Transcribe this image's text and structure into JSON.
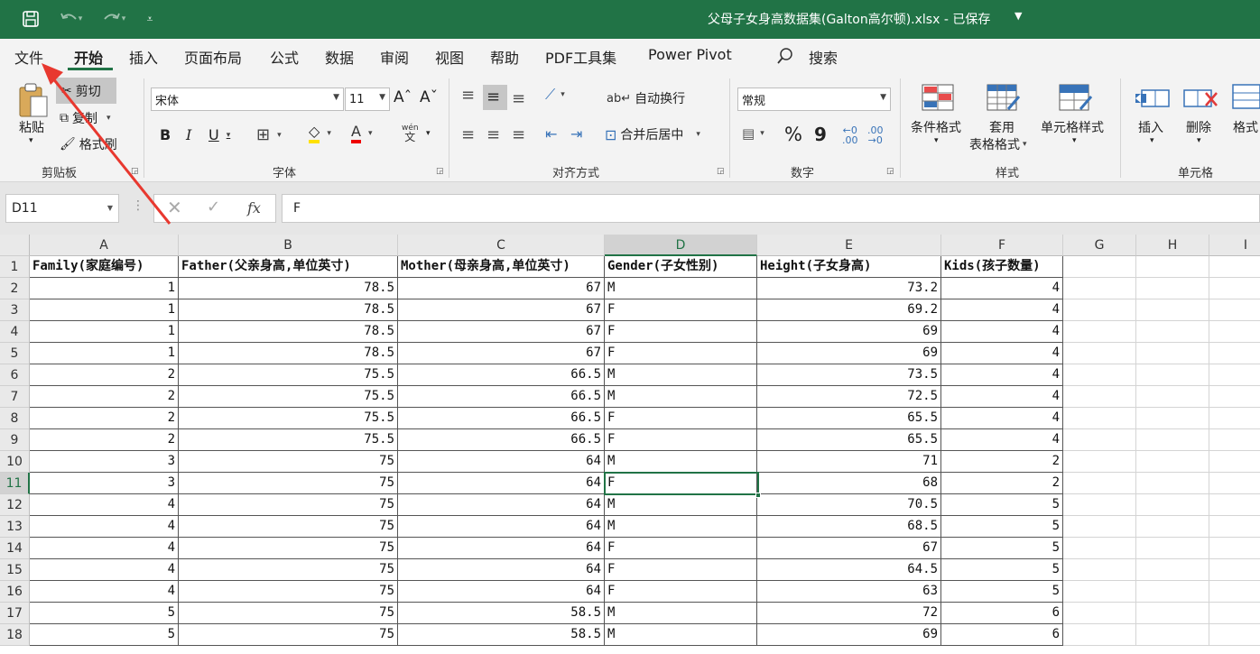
{
  "title_bar": {
    "doc_title": "父母子女身高数据集(Galton高尔顿).xlsx  -  已保存",
    "bg_color": "#217346",
    "icons": [
      "save-icon",
      "undo-icon",
      "redo-icon",
      "customize-icon"
    ]
  },
  "menu": {
    "tabs": [
      "文件",
      "开始",
      "插入",
      "页面布局",
      "公式",
      "数据",
      "审阅",
      "视图",
      "帮助",
      "PDF工具集",
      "Power Pivot"
    ],
    "active": "开始",
    "search_label": "搜索"
  },
  "ribbon": {
    "clipboard": {
      "paste": "粘贴",
      "cut": "剪切",
      "copy": "复制",
      "format_painter": "格式刷",
      "label": "剪贴板"
    },
    "font": {
      "font_name": "宋体",
      "font_size": "11",
      "label": "字体",
      "phonetic": "wén"
    },
    "alignment": {
      "wrap_text": "自动换行",
      "merge_center": "合并后居中",
      "label": "对齐方式"
    },
    "number": {
      "format": "常规",
      "percent": "%",
      "comma": "9",
      "label": "数字"
    },
    "styles": {
      "conditional": "条件格式",
      "table_line1": "套用",
      "table_line2": "表格格式",
      "cell_styles": "单元格样式",
      "label": "样式"
    },
    "cells": {
      "insert": "插入",
      "delete": "删除",
      "format": "格式",
      "label": "单元格"
    }
  },
  "formula_bar": {
    "name_box": "D11",
    "fx": "fx",
    "content": "F"
  },
  "sheet": {
    "columns": [
      "A",
      "B",
      "C",
      "D",
      "E",
      "F",
      "G",
      "H",
      "I"
    ],
    "selected_column": "D",
    "selected_row": 11,
    "active_cell": "D11",
    "header_row": [
      "Family(家庭编号)",
      "Father(父亲身高,单位英寸)",
      "Mother(母亲身高,单位英寸)",
      "Gender(子女性别)",
      "Height(子女身高)",
      "Kids(孩子数量)"
    ],
    "rows": [
      [
        "1",
        "78.5",
        "67",
        "M",
        "73.2",
        "4"
      ],
      [
        "1",
        "78.5",
        "67",
        "F",
        "69.2",
        "4"
      ],
      [
        "1",
        "78.5",
        "67",
        "F",
        "69",
        "4"
      ],
      [
        "1",
        "78.5",
        "67",
        "F",
        "69",
        "4"
      ],
      [
        "2",
        "75.5",
        "66.5",
        "M",
        "73.5",
        "4"
      ],
      [
        "2",
        "75.5",
        "66.5",
        "M",
        "72.5",
        "4"
      ],
      [
        "2",
        "75.5",
        "66.5",
        "F",
        "65.5",
        "4"
      ],
      [
        "2",
        "75.5",
        "66.5",
        "F",
        "65.5",
        "4"
      ],
      [
        "3",
        "75",
        "64",
        "M",
        "71",
        "2"
      ],
      [
        "3",
        "75",
        "64",
        "F",
        "68",
        "2"
      ],
      [
        "4",
        "75",
        "64",
        "M",
        "70.5",
        "5"
      ],
      [
        "4",
        "75",
        "64",
        "M",
        "68.5",
        "5"
      ],
      [
        "4",
        "75",
        "64",
        "F",
        "67",
        "5"
      ],
      [
        "4",
        "75",
        "64",
        "F",
        "64.5",
        "5"
      ],
      [
        "4",
        "75",
        "64",
        "F",
        "63",
        "5"
      ],
      [
        "5",
        "75",
        "58.5",
        "M",
        "72",
        "6"
      ],
      [
        "5",
        "75",
        "58.5",
        "M",
        "69",
        "6"
      ]
    ]
  },
  "annotation": {
    "color": "#e8382f",
    "target": "文件"
  }
}
